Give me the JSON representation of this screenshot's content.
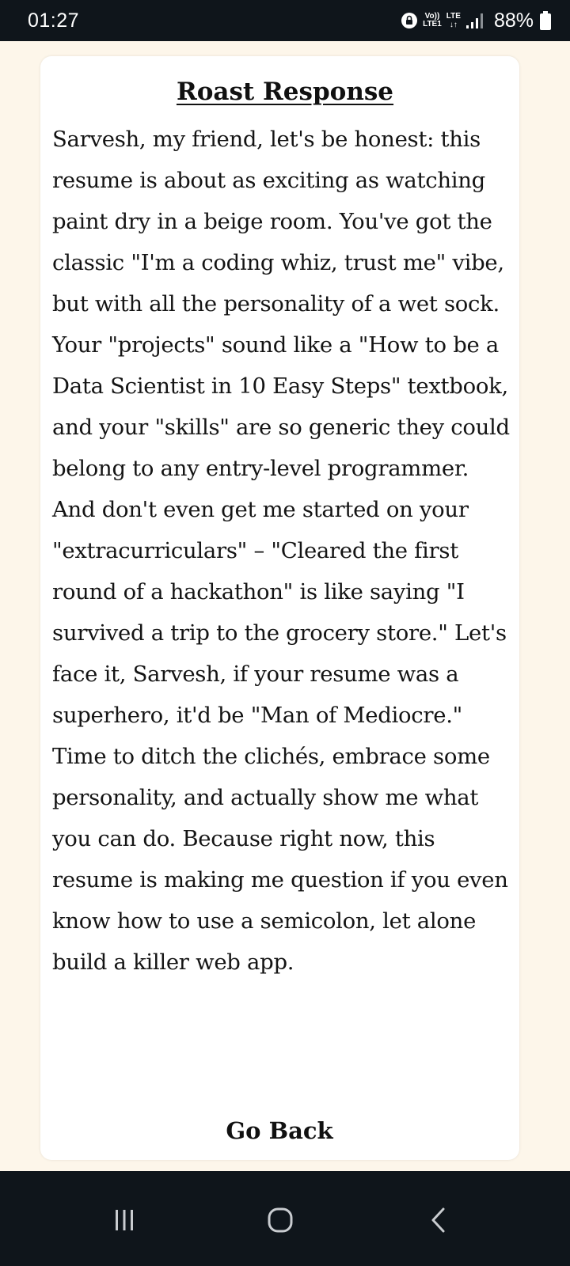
{
  "status_bar": {
    "time": "01:27",
    "volte_top": "Vo))",
    "volte_bottom": "LTE1",
    "lte_label": "LTE",
    "lte_arrows": "↓↑",
    "battery_percent": "88%",
    "icons": [
      "lock-icon",
      "signal-icon",
      "battery-icon"
    ]
  },
  "card": {
    "title": "Roast Response",
    "body": "Sarvesh, my friend, let's be honest: this resume is about as exciting as watching paint dry in a beige room. You've got the classic \"I'm a coding whiz, trust me\" vibe, but with all the personality of a wet sock. Your \"projects\" sound like a \"How to be a Data Scientist in 10 Easy Steps\" textbook, and your \"skills\" are so generic they could belong to any entry-level programmer. And don't even get me started on your \"extracurriculars\" – \"Cleared the first round of a hackathon\" is like saying \"I survived a trip to the grocery store.\" Let's face it, Sarvesh, if your resume was a superhero, it'd be \"Man of Mediocre.\" Time to ditch the clichés, embrace some personality, and actually show me what you can do. Because right now, this resume is making me question if you even know how to use a semicolon, let alone build a killer web app.",
    "go_back_label": "Go Back"
  },
  "nav_bar": {
    "icons": [
      "recents-icon",
      "home-icon",
      "back-icon"
    ]
  },
  "colors": {
    "page_background": "#fdf6ea",
    "card_background": "#ffffff",
    "system_bars": "#0f151b",
    "text": "#141414"
  }
}
